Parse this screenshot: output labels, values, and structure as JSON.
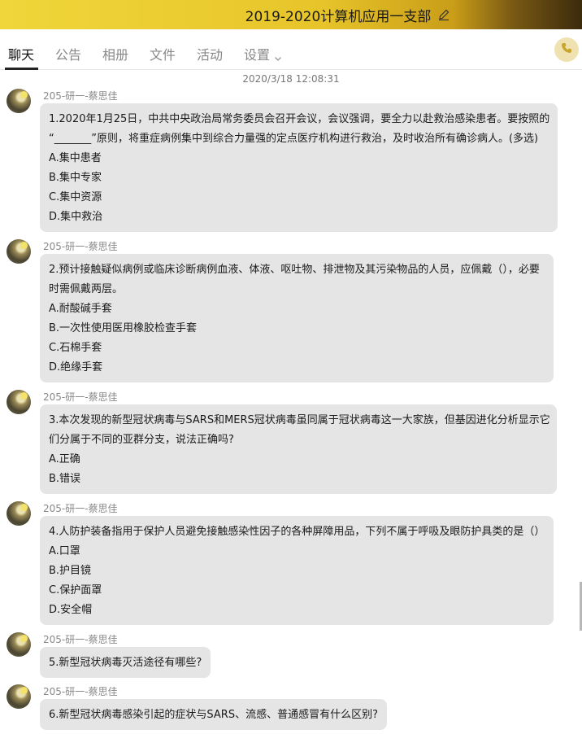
{
  "header": {
    "title": "2019-2020计算机应用一支部"
  },
  "tabs": [
    "聊天",
    "公告",
    "相册",
    "文件",
    "活动",
    "设置"
  ],
  "chat": {
    "timestamp": "2020/3/18 12:08:31",
    "messages": [
      {
        "sender": "205-研一-蔡思佳",
        "lines": [
          "1.2020年1月25日，中共中央政治局常务委员会召开会议，会议强调，要全力以赴救治感染患者。要按照的",
          "“_______”原则，将重症病例集中到综合力量强的定点医疗机构进行救治，及时收治所有确诊病人。(多选)",
          "A.集中患者",
          "B.集中专家",
          "C.集中资源",
          "D.集中救治"
        ]
      },
      {
        "sender": "205-研一-蔡思佳",
        "lines": [
          "2.预计接触疑似病例或临床诊断病例血液、体液、呕吐物、排泄物及其污染物品的人员，应佩戴（），必要",
          "时需佩戴两层。",
          "A.耐酸碱手套",
          "B.一次性使用医用橡胶检查手套",
          "C.石棉手套",
          "D.绝缘手套"
        ]
      },
      {
        "sender": "205-研一-蔡思佳",
        "lines": [
          "3.本次发现的新型冠状病毒与SARS和MERS冠状病毒虽同属于冠状病毒这一大家族，但基因进化分析显示它",
          "们分属于不同的亚群分支，说法正确吗?",
          "A.正确",
          "B.错误"
        ]
      },
      {
        "sender": "205-研一-蔡思佳",
        "lines": [
          "4.人防护装备指用于保护人员避免接触感染性因子的各种屏障用品，下列不属于呼吸及眼防护具类的是（）",
          "A.口罩",
          "B.护目镜",
          "C.保护面罩",
          "D.安全帽"
        ]
      },
      {
        "sender": "205-研一-蔡思佳",
        "lines": [
          "5.新型冠状病毒灭活途径有哪些?"
        ]
      },
      {
        "sender": "205-研一-蔡思佳",
        "lines": [
          "6.新型冠状病毒感染引起的症状与SARS、流感、普通感冒有什么区别?"
        ]
      }
    ]
  },
  "icons": {
    "edit": "edit-icon",
    "settings_dropdown": "chevron-down-icon",
    "call": "phone-icon"
  },
  "colors": {
    "accent": "#e7c52a",
    "bubble": "#e5e5e5"
  }
}
